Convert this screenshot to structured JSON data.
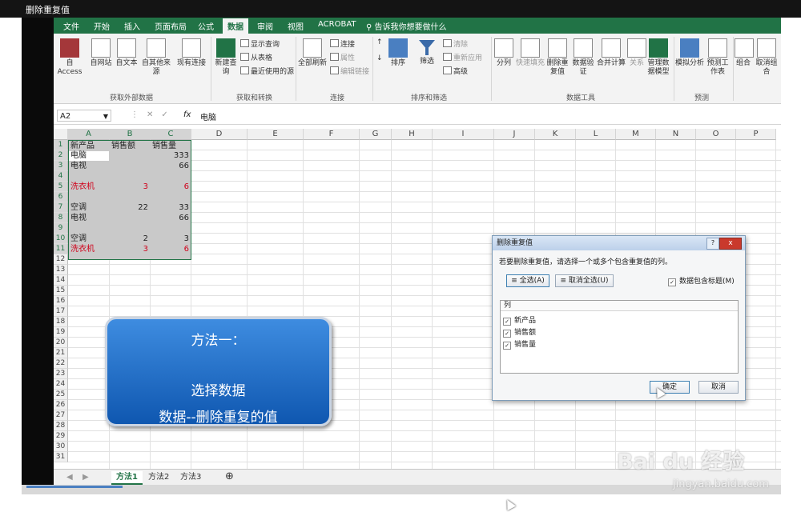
{
  "window": {
    "title": "删除重复值"
  },
  "ribbon": {
    "tabs": [
      "文件",
      "开始",
      "插入",
      "页面布局",
      "公式",
      "数据",
      "审阅",
      "视图",
      "ACROBAT"
    ],
    "active_tab": "数据",
    "tell_me": "告诉我你想要做什么",
    "external": {
      "access": "自 Access",
      "web": "自网站",
      "text": "自文本",
      "other": "自其他来源",
      "existing": "现有连接",
      "group": "获取外部数据"
    },
    "transform": {
      "new_query": "新建查询",
      "show_queries": "显示查询",
      "from_table": "从表格",
      "recent": "最近使用的源",
      "group": "获取和转换"
    },
    "connections": {
      "refresh_all": "全部刷新",
      "conn": "连接",
      "props": "属性",
      "edit_links": "编辑链接",
      "group": "连接"
    },
    "sort_filter": {
      "sort": "排序",
      "filter": "筛选",
      "clear": "清除",
      "reapply": "重新应用",
      "advanced": "高级",
      "group": "排序和筛选"
    },
    "data_tools": {
      "split": "分列",
      "flash_fill": "快速填充",
      "remove_dup": "删除重复值",
      "validation": "数据验证",
      "consolidate": "合并计算",
      "relations": "关系",
      "manage_model": "管理数据模型",
      "group": "数据工具"
    },
    "forecast": {
      "what_if": "模拟分析",
      "forecast_sheet": "预测工作表",
      "group": "预测"
    },
    "outline": {
      "group_btn": "组合",
      "ungroup": "取消组合"
    }
  },
  "formula_bar": {
    "name_box": "A2",
    "value": "电脑",
    "fx": "fx"
  },
  "sheet": {
    "columns": [
      "A",
      "B",
      "C",
      "D",
      "E",
      "F",
      "G",
      "H",
      "I",
      "J",
      "K",
      "L",
      "M",
      "N",
      "O",
      "P"
    ],
    "rows": [
      "1",
      "2",
      "3",
      "4",
      "5",
      "6",
      "7",
      "8",
      "9",
      "10",
      "11",
      "12",
      "13",
      "14",
      "15",
      "16",
      "17",
      "18",
      "19",
      "20",
      "21",
      "22",
      "23",
      "24",
      "25",
      "26",
      "27",
      "28",
      "29",
      "30",
      "31"
    ],
    "header": [
      "新产品",
      "销售额",
      "销售量"
    ],
    "data": [
      {
        "row": 2,
        "a": "电脑",
        "b": "",
        "c": "333",
        "red": false
      },
      {
        "row": 3,
        "a": "电视",
        "b": "",
        "c": "66",
        "red": false
      },
      {
        "row": 5,
        "a": "洗衣机",
        "b": "3",
        "c": "6",
        "red": true
      },
      {
        "row": 7,
        "a": "空调",
        "b": "22",
        "c": "33",
        "red": false
      },
      {
        "row": 8,
        "a": "电视",
        "b": "",
        "c": "66",
        "red": false
      },
      {
        "row": 10,
        "a": "空调",
        "b": "2",
        "c": "3",
        "red": false
      },
      {
        "row": 11,
        "a": "洗衣机",
        "b": "3",
        "c": "6",
        "red": true
      }
    ]
  },
  "sheet_tabs": [
    "方法1",
    "方法2",
    "方法3"
  ],
  "active_sheet": "方法1",
  "callout": {
    "title": "方法一：",
    "line1": "选择数据",
    "line2": "数据--删除重复的值"
  },
  "dialog": {
    "title": "删除重复值",
    "description": "若要删除重复值，请选择一个或多个包含重复值的列。",
    "select_all": "全选(A)",
    "unselect_all": "取消全选(U)",
    "has_headers": "数据包含标题(M)",
    "list_header": "列",
    "columns": [
      "新产品",
      "销售额",
      "销售量"
    ],
    "ok": "确定",
    "cancel": "取消",
    "help": "?",
    "close": "x"
  },
  "watermark": {
    "brand": "Bai du 经验",
    "url": "jingyan.baidu.com"
  },
  "colors": {
    "excel_green": "#217346",
    "callout_blue": "#1a6bc9",
    "red_text": "#d0021b"
  }
}
